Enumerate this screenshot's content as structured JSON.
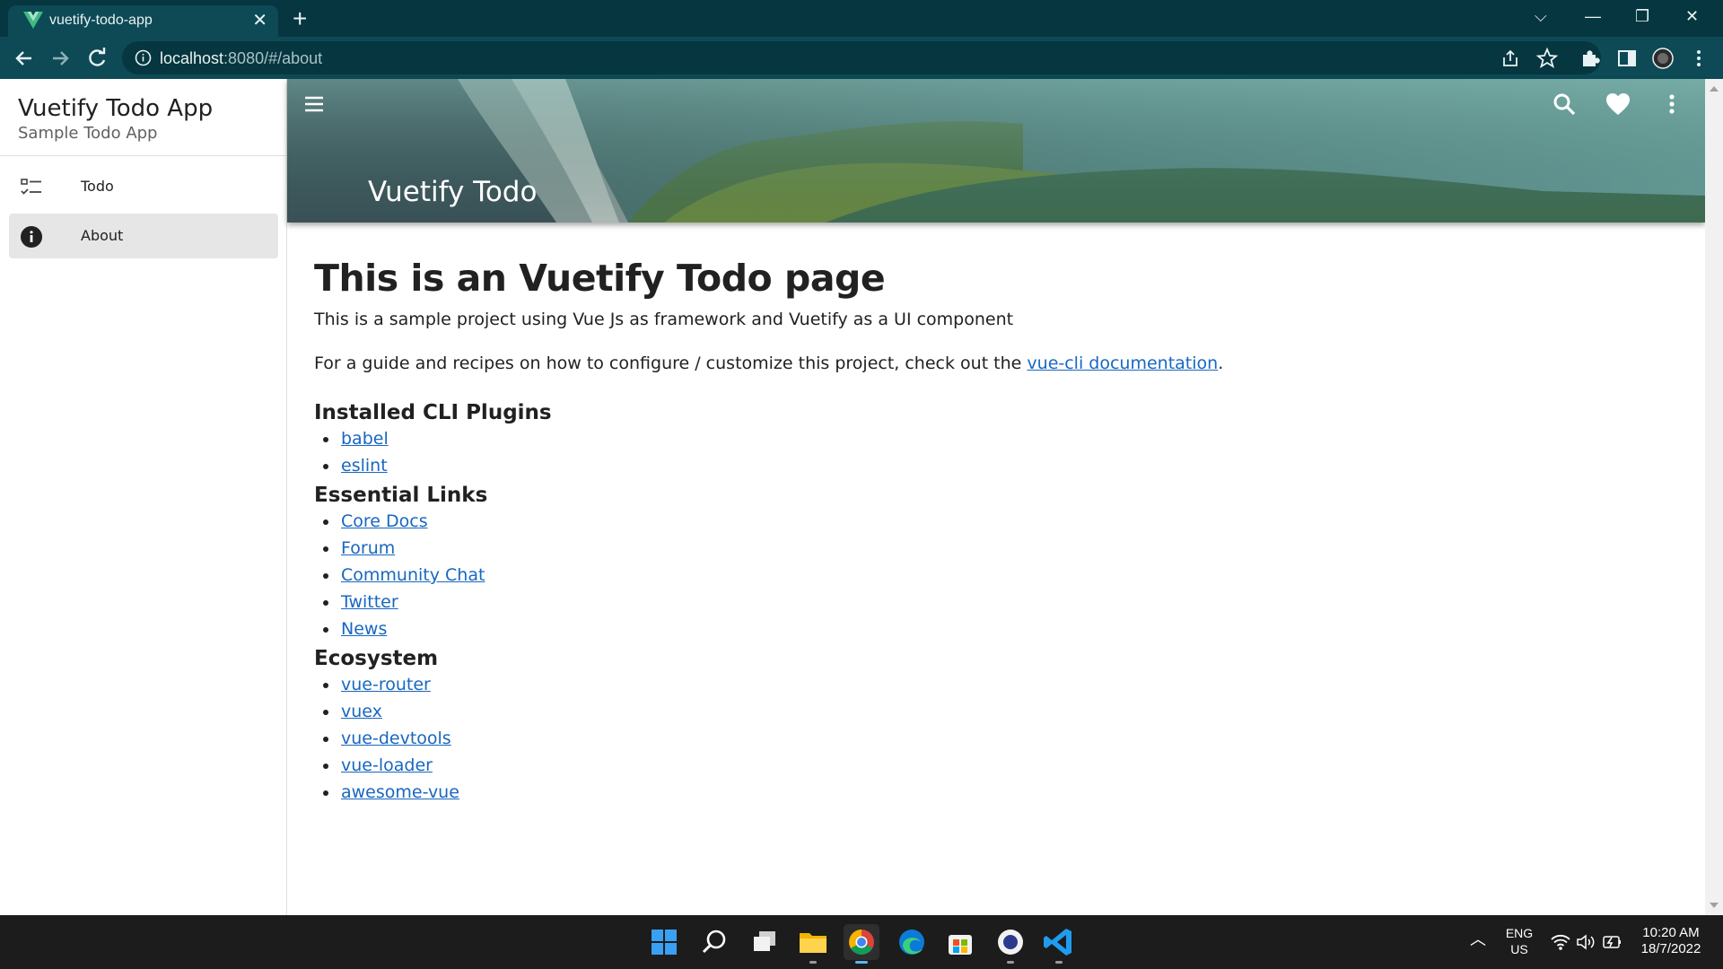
{
  "browser": {
    "tab_title": "vuetify-todo-app",
    "url_host": "localhost",
    "url_rest": ":8080/#/about"
  },
  "drawer": {
    "title": "Vuetify Todo App",
    "subtitle": "Sample Todo App",
    "items": [
      {
        "label": "Todo",
        "icon": "checklist-icon",
        "active": false
      },
      {
        "label": "About",
        "icon": "info-icon",
        "active": true
      }
    ]
  },
  "appbar": {
    "title": "Vuetify Todo",
    "icons": [
      "menu-icon",
      "search-icon",
      "heart-icon",
      "more-vert-icon"
    ]
  },
  "content": {
    "heading": "This is an Vuetify Todo page",
    "intro": "This is a sample project using Vue Js as framework and Vuetify as a UI component",
    "guide_prefix": "For a guide and recipes on how to configure / customize this project, check out the ",
    "guide_link": "vue-cli documentation",
    "guide_suffix": ".",
    "sections": [
      {
        "title": "Installed CLI Plugins",
        "links": [
          "babel",
          "eslint"
        ]
      },
      {
        "title": "Essential Links",
        "links": [
          "Core Docs",
          "Forum",
          "Community Chat",
          "Twitter",
          "News"
        ]
      },
      {
        "title": "Ecosystem",
        "links": [
          "vue-router",
          "vuex",
          "vue-devtools",
          "vue-loader",
          "awesome-vue"
        ]
      }
    ]
  },
  "taskbar": {
    "apps": [
      "windows-start-icon",
      "search-icon",
      "task-view-icon",
      "file-explorer-icon",
      "chrome-icon",
      "edge-icon",
      "store-icon",
      "app-icon",
      "vscode-icon"
    ],
    "lang_top": "ENG",
    "lang_bottom": "US",
    "time": "10:20 AM",
    "date": "18/7/2022"
  },
  "colors": {
    "tabbar": "#06363f",
    "toolbar": "#0d4a56",
    "link": "#1867c0",
    "drawer_active": "#e6e6e6"
  }
}
